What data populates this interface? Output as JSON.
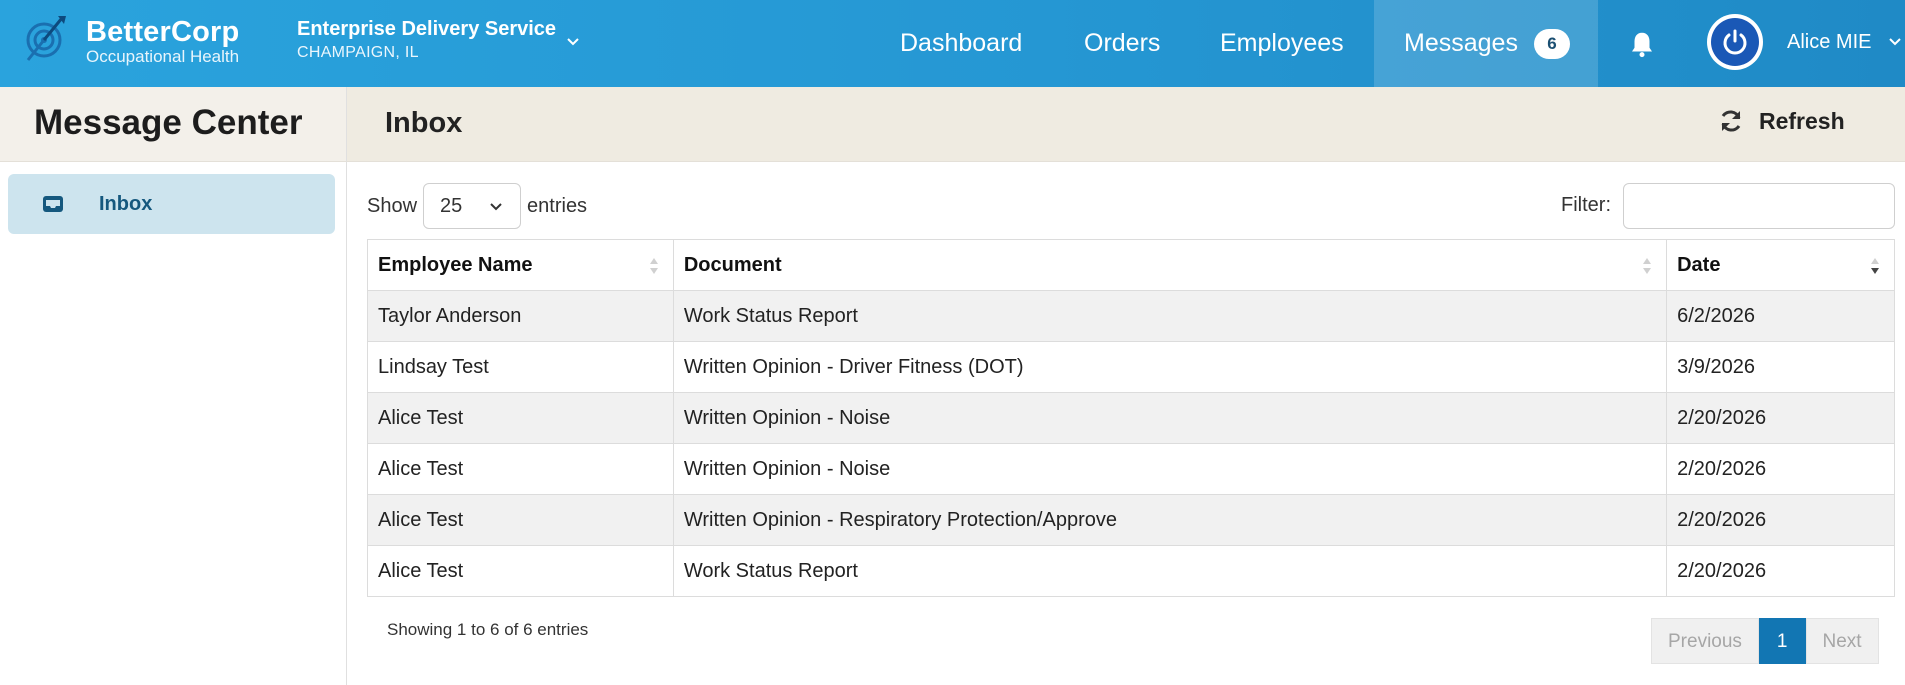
{
  "brand": {
    "name": "BetterCorp",
    "subtitle": "Occupational Health"
  },
  "company": {
    "name": "Enterprise Delivery Service",
    "location": "CHAMPAIGN, IL"
  },
  "nav": {
    "dashboard": "Dashboard",
    "orders": "Orders",
    "employees": "Employees",
    "messages": "Messages",
    "messages_count": "6"
  },
  "user": {
    "name": "Alice MIE"
  },
  "sidebar": {
    "title": "Message Center",
    "items": [
      {
        "label": "Inbox",
        "icon": "inbox-icon",
        "active": true
      }
    ]
  },
  "main": {
    "title": "Inbox",
    "refresh_label": "Refresh",
    "show_label": "Show",
    "page_size": "25",
    "entries_label": "entries",
    "filter_label": "Filter:",
    "filter_value": ""
  },
  "table": {
    "columns": [
      "Employee Name",
      "Document",
      "Date"
    ],
    "rows": [
      [
        "Taylor Anderson",
        "Work Status Report",
        "6/2/2026"
      ],
      [
        "Lindsay Test",
        "Written Opinion - Driver Fitness (DOT)",
        "3/9/2026"
      ],
      [
        "Alice Test",
        "Written Opinion - Noise",
        "2/20/2026"
      ],
      [
        "Alice Test",
        "Written Opinion - Noise",
        "2/20/2026"
      ],
      [
        "Alice Test",
        "Written Opinion - Respiratory Protection/Approve",
        "2/20/2026"
      ],
      [
        "Alice Test",
        "Work Status Report",
        "2/20/2026"
      ]
    ]
  },
  "footer": {
    "info": "Showing 1 to 6 of 6 entries",
    "previous": "Previous",
    "current_page": "1",
    "next": "Next"
  },
  "colors": {
    "nav_bg": "#2597d3",
    "active_side": "#cde4ee",
    "page_btn": "#1276b3"
  }
}
